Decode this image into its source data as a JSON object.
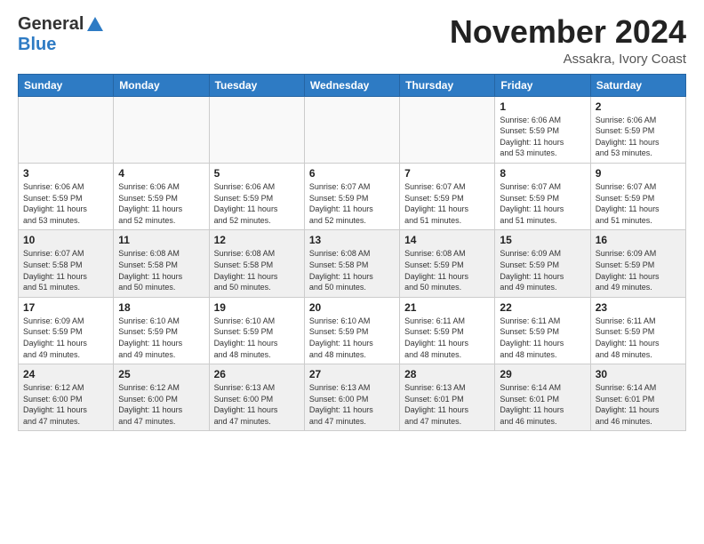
{
  "header": {
    "logo_general": "General",
    "logo_blue": "Blue",
    "month_title": "November 2024",
    "location": "Assakra, Ivory Coast"
  },
  "weekdays": [
    "Sunday",
    "Monday",
    "Tuesday",
    "Wednesday",
    "Thursday",
    "Friday",
    "Saturday"
  ],
  "weeks": [
    [
      {
        "day": "",
        "info": ""
      },
      {
        "day": "",
        "info": ""
      },
      {
        "day": "",
        "info": ""
      },
      {
        "day": "",
        "info": ""
      },
      {
        "day": "",
        "info": ""
      },
      {
        "day": "1",
        "info": "Sunrise: 6:06 AM\nSunset: 5:59 PM\nDaylight: 11 hours\nand 53 minutes."
      },
      {
        "day": "2",
        "info": "Sunrise: 6:06 AM\nSunset: 5:59 PM\nDaylight: 11 hours\nand 53 minutes."
      }
    ],
    [
      {
        "day": "3",
        "info": "Sunrise: 6:06 AM\nSunset: 5:59 PM\nDaylight: 11 hours\nand 53 minutes."
      },
      {
        "day": "4",
        "info": "Sunrise: 6:06 AM\nSunset: 5:59 PM\nDaylight: 11 hours\nand 52 minutes."
      },
      {
        "day": "5",
        "info": "Sunrise: 6:06 AM\nSunset: 5:59 PM\nDaylight: 11 hours\nand 52 minutes."
      },
      {
        "day": "6",
        "info": "Sunrise: 6:07 AM\nSunset: 5:59 PM\nDaylight: 11 hours\nand 52 minutes."
      },
      {
        "day": "7",
        "info": "Sunrise: 6:07 AM\nSunset: 5:59 PM\nDaylight: 11 hours\nand 51 minutes."
      },
      {
        "day": "8",
        "info": "Sunrise: 6:07 AM\nSunset: 5:59 PM\nDaylight: 11 hours\nand 51 minutes."
      },
      {
        "day": "9",
        "info": "Sunrise: 6:07 AM\nSunset: 5:59 PM\nDaylight: 11 hours\nand 51 minutes."
      }
    ],
    [
      {
        "day": "10",
        "info": "Sunrise: 6:07 AM\nSunset: 5:58 PM\nDaylight: 11 hours\nand 51 minutes."
      },
      {
        "day": "11",
        "info": "Sunrise: 6:08 AM\nSunset: 5:58 PM\nDaylight: 11 hours\nand 50 minutes."
      },
      {
        "day": "12",
        "info": "Sunrise: 6:08 AM\nSunset: 5:58 PM\nDaylight: 11 hours\nand 50 minutes."
      },
      {
        "day": "13",
        "info": "Sunrise: 6:08 AM\nSunset: 5:58 PM\nDaylight: 11 hours\nand 50 minutes."
      },
      {
        "day": "14",
        "info": "Sunrise: 6:08 AM\nSunset: 5:59 PM\nDaylight: 11 hours\nand 50 minutes."
      },
      {
        "day": "15",
        "info": "Sunrise: 6:09 AM\nSunset: 5:59 PM\nDaylight: 11 hours\nand 49 minutes."
      },
      {
        "day": "16",
        "info": "Sunrise: 6:09 AM\nSunset: 5:59 PM\nDaylight: 11 hours\nand 49 minutes."
      }
    ],
    [
      {
        "day": "17",
        "info": "Sunrise: 6:09 AM\nSunset: 5:59 PM\nDaylight: 11 hours\nand 49 minutes."
      },
      {
        "day": "18",
        "info": "Sunrise: 6:10 AM\nSunset: 5:59 PM\nDaylight: 11 hours\nand 49 minutes."
      },
      {
        "day": "19",
        "info": "Sunrise: 6:10 AM\nSunset: 5:59 PM\nDaylight: 11 hours\nand 48 minutes."
      },
      {
        "day": "20",
        "info": "Sunrise: 6:10 AM\nSunset: 5:59 PM\nDaylight: 11 hours\nand 48 minutes."
      },
      {
        "day": "21",
        "info": "Sunrise: 6:11 AM\nSunset: 5:59 PM\nDaylight: 11 hours\nand 48 minutes."
      },
      {
        "day": "22",
        "info": "Sunrise: 6:11 AM\nSunset: 5:59 PM\nDaylight: 11 hours\nand 48 minutes."
      },
      {
        "day": "23",
        "info": "Sunrise: 6:11 AM\nSunset: 5:59 PM\nDaylight: 11 hours\nand 48 minutes."
      }
    ],
    [
      {
        "day": "24",
        "info": "Sunrise: 6:12 AM\nSunset: 6:00 PM\nDaylight: 11 hours\nand 47 minutes."
      },
      {
        "day": "25",
        "info": "Sunrise: 6:12 AM\nSunset: 6:00 PM\nDaylight: 11 hours\nand 47 minutes."
      },
      {
        "day": "26",
        "info": "Sunrise: 6:13 AM\nSunset: 6:00 PM\nDaylight: 11 hours\nand 47 minutes."
      },
      {
        "day": "27",
        "info": "Sunrise: 6:13 AM\nSunset: 6:00 PM\nDaylight: 11 hours\nand 47 minutes."
      },
      {
        "day": "28",
        "info": "Sunrise: 6:13 AM\nSunset: 6:01 PM\nDaylight: 11 hours\nand 47 minutes."
      },
      {
        "day": "29",
        "info": "Sunrise: 6:14 AM\nSunset: 6:01 PM\nDaylight: 11 hours\nand 46 minutes."
      },
      {
        "day": "30",
        "info": "Sunrise: 6:14 AM\nSunset: 6:01 PM\nDaylight: 11 hours\nand 46 minutes."
      }
    ]
  ]
}
